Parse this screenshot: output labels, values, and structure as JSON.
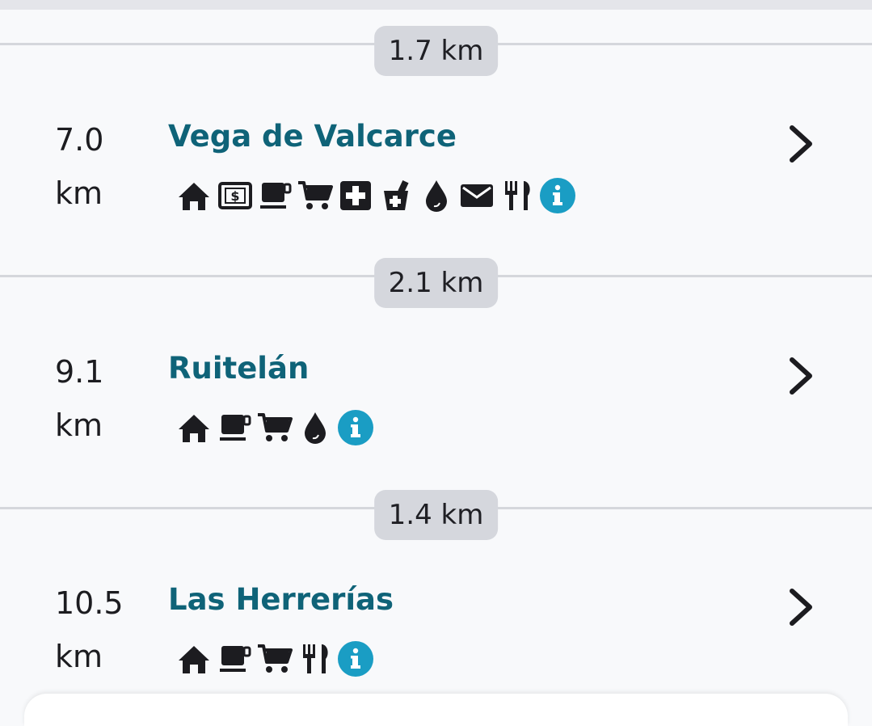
{
  "segments": [
    {
      "distance": "1.7 km"
    },
    {
      "distance": "2.1 km"
    },
    {
      "distance": "1.4 km"
    }
  ],
  "stops": [
    {
      "distance": "7.0\nkm",
      "name": "Vega de Valcarce",
      "services": [
        "house-icon",
        "atm-icon",
        "coffee-icon",
        "cart-icon",
        "medical-icon",
        "pharmacy-icon",
        "water-icon",
        "mail-icon",
        "restaurant-icon",
        "info-icon"
      ]
    },
    {
      "distance": "9.1\nkm",
      "name": "Ruitelán",
      "services": [
        "house-icon",
        "coffee-icon",
        "cart-icon",
        "water-icon",
        "info-icon"
      ]
    },
    {
      "distance": "10.5\nkm",
      "name": "Las Herrerías",
      "services": [
        "house-icon",
        "coffee-icon",
        "cart-icon",
        "restaurant-icon",
        "info-icon"
      ]
    }
  ],
  "colors": {
    "accent": "#0f6378",
    "info": "#1a9dc4",
    "icon": "#1c1c20"
  }
}
